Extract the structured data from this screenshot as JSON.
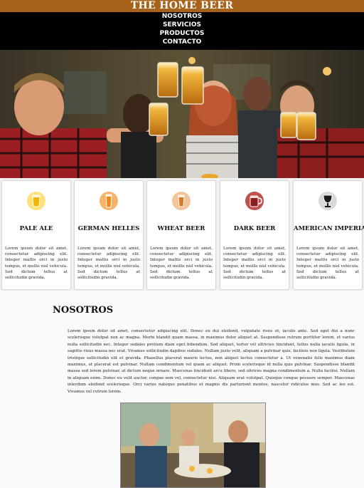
{
  "header": {
    "title": "THE HOME BEER"
  },
  "nav": {
    "items": [
      "NOSOTROS",
      "SERVICIOS",
      "PRODUCTOS",
      "CONTACTO"
    ]
  },
  "hero": {
    "image": "people-toasting-beer-photo"
  },
  "cards": [
    {
      "title": "PALE ALE",
      "icon": "pale-ale-glass-icon",
      "color": "#f3b600",
      "text": "Lorem ipsum dolor sit amet, consectetur adipiscing elit. Integer mattis orci in justo tempus, et mollis nisl vehicula. Sed dictum tellus at sollicitudin gravida."
    },
    {
      "title": "GERMAN HELLES",
      "icon": "helles-glass-icon",
      "color": "#ef8a1e",
      "text": "Lorem ipsum dolor sit amet, consectetur adipiscing elit. Integer mattis orci in justo tempus, et mollis nisl vehicula. Sed dictum tellus at sollicitudin gravida."
    },
    {
      "title": "WHEAT BEER",
      "icon": "wheat-beer-glass-icon",
      "color": "#d9782a",
      "text": "Lorem ipsum dolor sit amet, consectetur adipiscing elit. Integer mattis orci in justo tempus, et mollis nisl vehicula. Sed dictum tellus at sollicitudin gravida."
    },
    {
      "title": "DARK BEER",
      "icon": "dark-beer-mug-icon",
      "color": "#8a1d1d",
      "text": "Lorem ipsum dolor sit amet, consectetur adipiscing elit. Integer mattis orci in justo tempus, et mollis nisl vehicula. Sed dictum tellus at sollicitudin gravida."
    },
    {
      "title": "AMERICAN IMPERIAL",
      "icon": "imperial-goblet-icon",
      "color": "#1f1a17",
      "text": "Lorem ipsum dolor sit amet, consectetur adipiscing elit. Integer mattis orci in justo tempus, et mollis nisl vehicula. Sed dictum tellus at sollicitudin gravida."
    }
  ],
  "about": {
    "title": "NOSOTROS",
    "text": "Lorem ipsum dolor sit amet, consectetur adipiscing elit. Donec eu dui eleifend, vulputate risus ut, iaculis ante. Sed eget dui a nunc scelerisque volutpat non ac magna. Morbi blandit quam massa, in maximus dolor aliquet at. Suspendisse rutrum porttitor lorem, et varius nulla sollicitudin nec. Integer sodales pretium diam eget bibendum. Sed aliquet, tortor vel ultricies tincidunt, tellus nulla iaculis ligula, in sagittis risus massa nec erat. Vivamus sollicitudin dapibus sodales. Nullam justo velit, aliquam a pulvinar quis, facilisis non ligula. Vestibulum tristique sollicitudin elit et gravida. Phasellus placerat mauris lectus, non aliquet lectus consectetur a. Ut venenatis felis maximus diam maximus, et placerat est pulvinar. Nullam condimentum vel quam ac aliquet. Proin scelerisque id nulla quis pulvinar. Suspendisse blandit massa sed lorem pulvinar, at dictum neque ornare. Maecenas tincidunt arcu libero, sed ultrices magna condimentum a. Nulla facilisi. Nullam in aliquam enim. Donec eu velit auctor, congue sem vel, consectetur nisi. Aliquam erat volutpat. Quisque congue posuere semper. Maecenas interdum eleifend scelerisque. Orci varius natoque penatibus et magnis dis parturient montes, nascetur ridiculus mus. Sed ac leo est. Vivamus vel rutrum lorem.",
    "image": "friends-at-table-photo"
  }
}
